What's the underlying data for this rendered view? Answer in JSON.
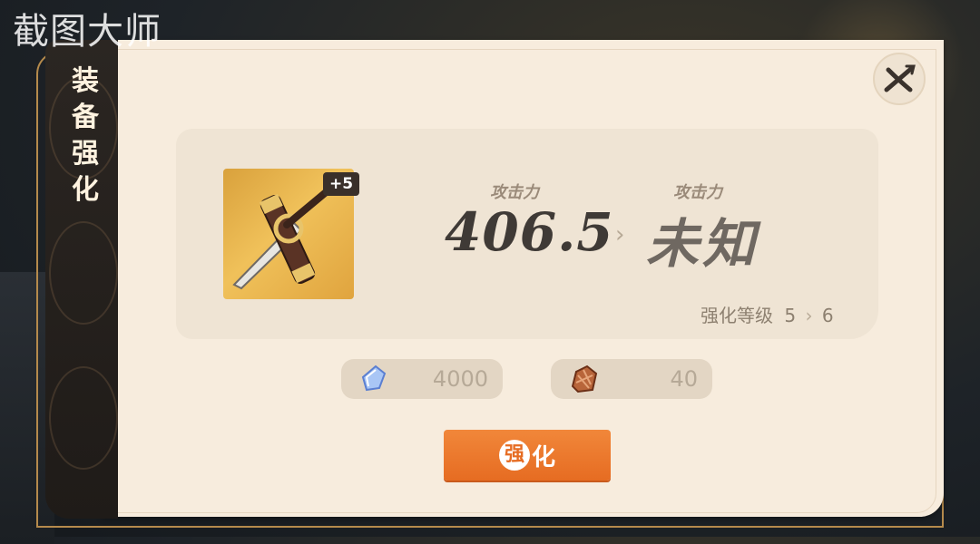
{
  "watermark": "截图大师",
  "side_tab": {
    "title": [
      "装",
      "备",
      "强",
      "化"
    ]
  },
  "close_icon": "close-x-icon",
  "item": {
    "icon": "dagger-icon",
    "level_badge": "+5"
  },
  "stats": {
    "current_label": "攻击力",
    "current_value": "406.5",
    "next_label": "攻击力",
    "next_value": "未知"
  },
  "enhance_level": {
    "label": "强化等级",
    "from": "5",
    "to": "6"
  },
  "costs": [
    {
      "icon": "crystal-icon",
      "amount": "4000"
    },
    {
      "icon": "ore-icon",
      "amount": "40"
    }
  ],
  "enhance_button": {
    "first_char": "强",
    "rest": "化"
  },
  "colors": {
    "panel": "#f7ecdd",
    "card": "#efe4d4",
    "button": "#e66c22",
    "frame": "#b58a4c"
  }
}
